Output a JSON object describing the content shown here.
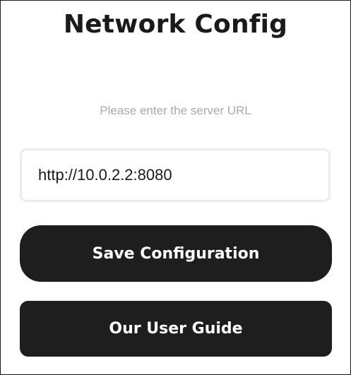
{
  "header": {
    "title": "Network Config"
  },
  "form": {
    "prompt": "Please enter the server URL",
    "server_url": {
      "value": "http://10.0.2.2:8080"
    }
  },
  "actions": {
    "save_label": "Save Configuration",
    "guide_label": "Our User Guide"
  },
  "colors": {
    "background": "#ffffff",
    "text": "#1a1a1a",
    "prompt_text": "#a9a9a9",
    "input_border": "#ececec",
    "button_background": "#1e1e1e",
    "button_text": "#ffffff"
  }
}
